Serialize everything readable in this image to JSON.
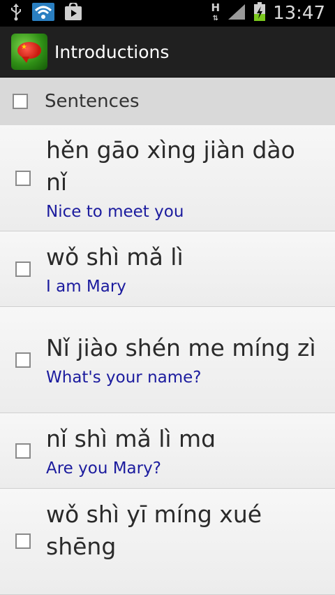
{
  "status_bar": {
    "time": "13:47",
    "network": "H",
    "icons": [
      "usb-icon",
      "wifi-icon",
      "play-store-icon",
      "signal-icon",
      "battery-charging-icon"
    ]
  },
  "action_bar": {
    "title": "Introductions",
    "icon": "app-logo-icon"
  },
  "section": {
    "title": "Sentences"
  },
  "sentences": [
    {
      "pinyin": "hěn gāo xìng jiàn dào nǐ",
      "english": "Nice to meet you"
    },
    {
      "pinyin": "wǒ shì mǎ lì",
      "english": "I am Mary"
    },
    {
      "pinyin": "Nǐ jiào shén me míng zì",
      "english": "What's your name?"
    },
    {
      "pinyin": "nǐ shì mǎ lì mɑ",
      "english": "Are you Mary?"
    },
    {
      "pinyin": "wǒ shì yī míng xué shēng",
      "english": ""
    }
  ],
  "colors": {
    "english_text": "#1b1b9e",
    "action_bar": "#202020",
    "section_header": "#d9d9d9"
  }
}
